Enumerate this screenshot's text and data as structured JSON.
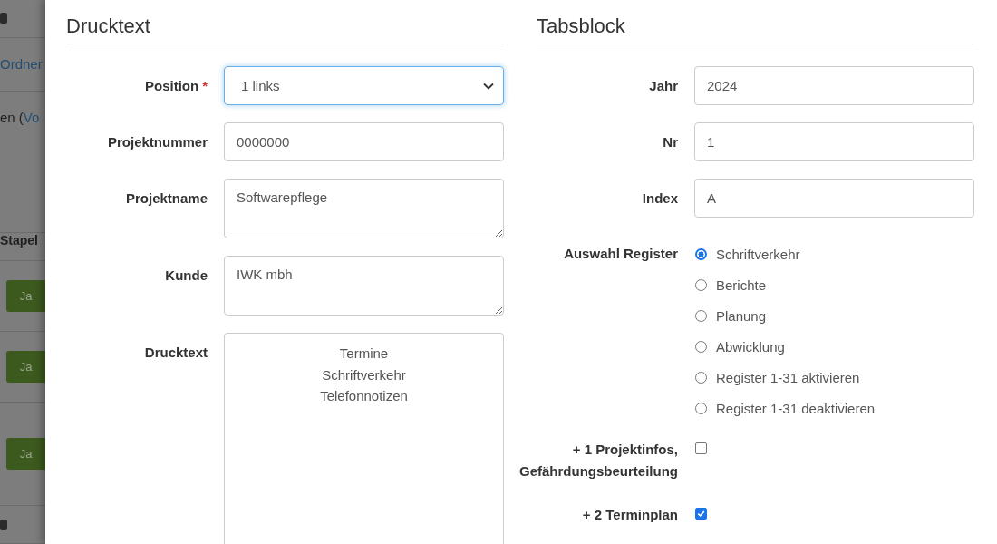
{
  "background": {
    "rows": [
      {
        "kind": "icon"
      },
      {
        "kind": "link",
        "text": "Ordner"
      },
      {
        "kind": "mixed",
        "text": "en (",
        "link": "Vo"
      },
      {
        "kind": "heading",
        "text": "Stapel"
      },
      {
        "kind": "button",
        "label": "Ja"
      },
      {
        "kind": "button",
        "label": "Ja"
      },
      {
        "kind": "button",
        "label": "Ja"
      },
      {
        "kind": "icon"
      }
    ]
  },
  "sections": [
    {
      "title": "Drucktext",
      "fields": [
        {
          "kind": "select",
          "label": "Position",
          "required_mark": "*",
          "value": "1 links",
          "focused": true
        },
        {
          "kind": "input",
          "label": "Projektnummer",
          "value": "0000000"
        },
        {
          "kind": "textarea",
          "label": "Projektname",
          "value": "Softwarepflege"
        },
        {
          "kind": "textarea",
          "label": "Kunde",
          "value": "IWK mbh"
        },
        {
          "kind": "bigtext",
          "label": "Drucktext",
          "value": "Termine\nSchriftverkehr\nTelefonnotizen"
        }
      ]
    },
    {
      "title": "Tabsblock",
      "fields": [
        {
          "kind": "input",
          "label": "Jahr",
          "value": "2024"
        },
        {
          "kind": "input",
          "label": "Nr",
          "value": "1"
        },
        {
          "kind": "input",
          "label": "Index",
          "value": "A"
        },
        {
          "kind": "radio",
          "label": "Auswahl Register",
          "options": [
            {
              "label": "Schriftverkehr",
              "selected": true
            },
            {
              "label": "Berichte",
              "selected": false
            },
            {
              "label": "Planung",
              "selected": false
            },
            {
              "label": "Abwicklung",
              "selected": false
            },
            {
              "label": "Register 1-31 aktivieren",
              "selected": false
            },
            {
              "label": "Register 1-31 deaktivieren",
              "selected": false
            }
          ]
        },
        {
          "kind": "checkbox",
          "label": "+ 1 Projektinfos, Gefährdungsbeurteilung",
          "checked": false
        },
        {
          "kind": "checkbox",
          "label": "+ 2 Terminplan",
          "checked": true
        }
      ]
    }
  ]
}
